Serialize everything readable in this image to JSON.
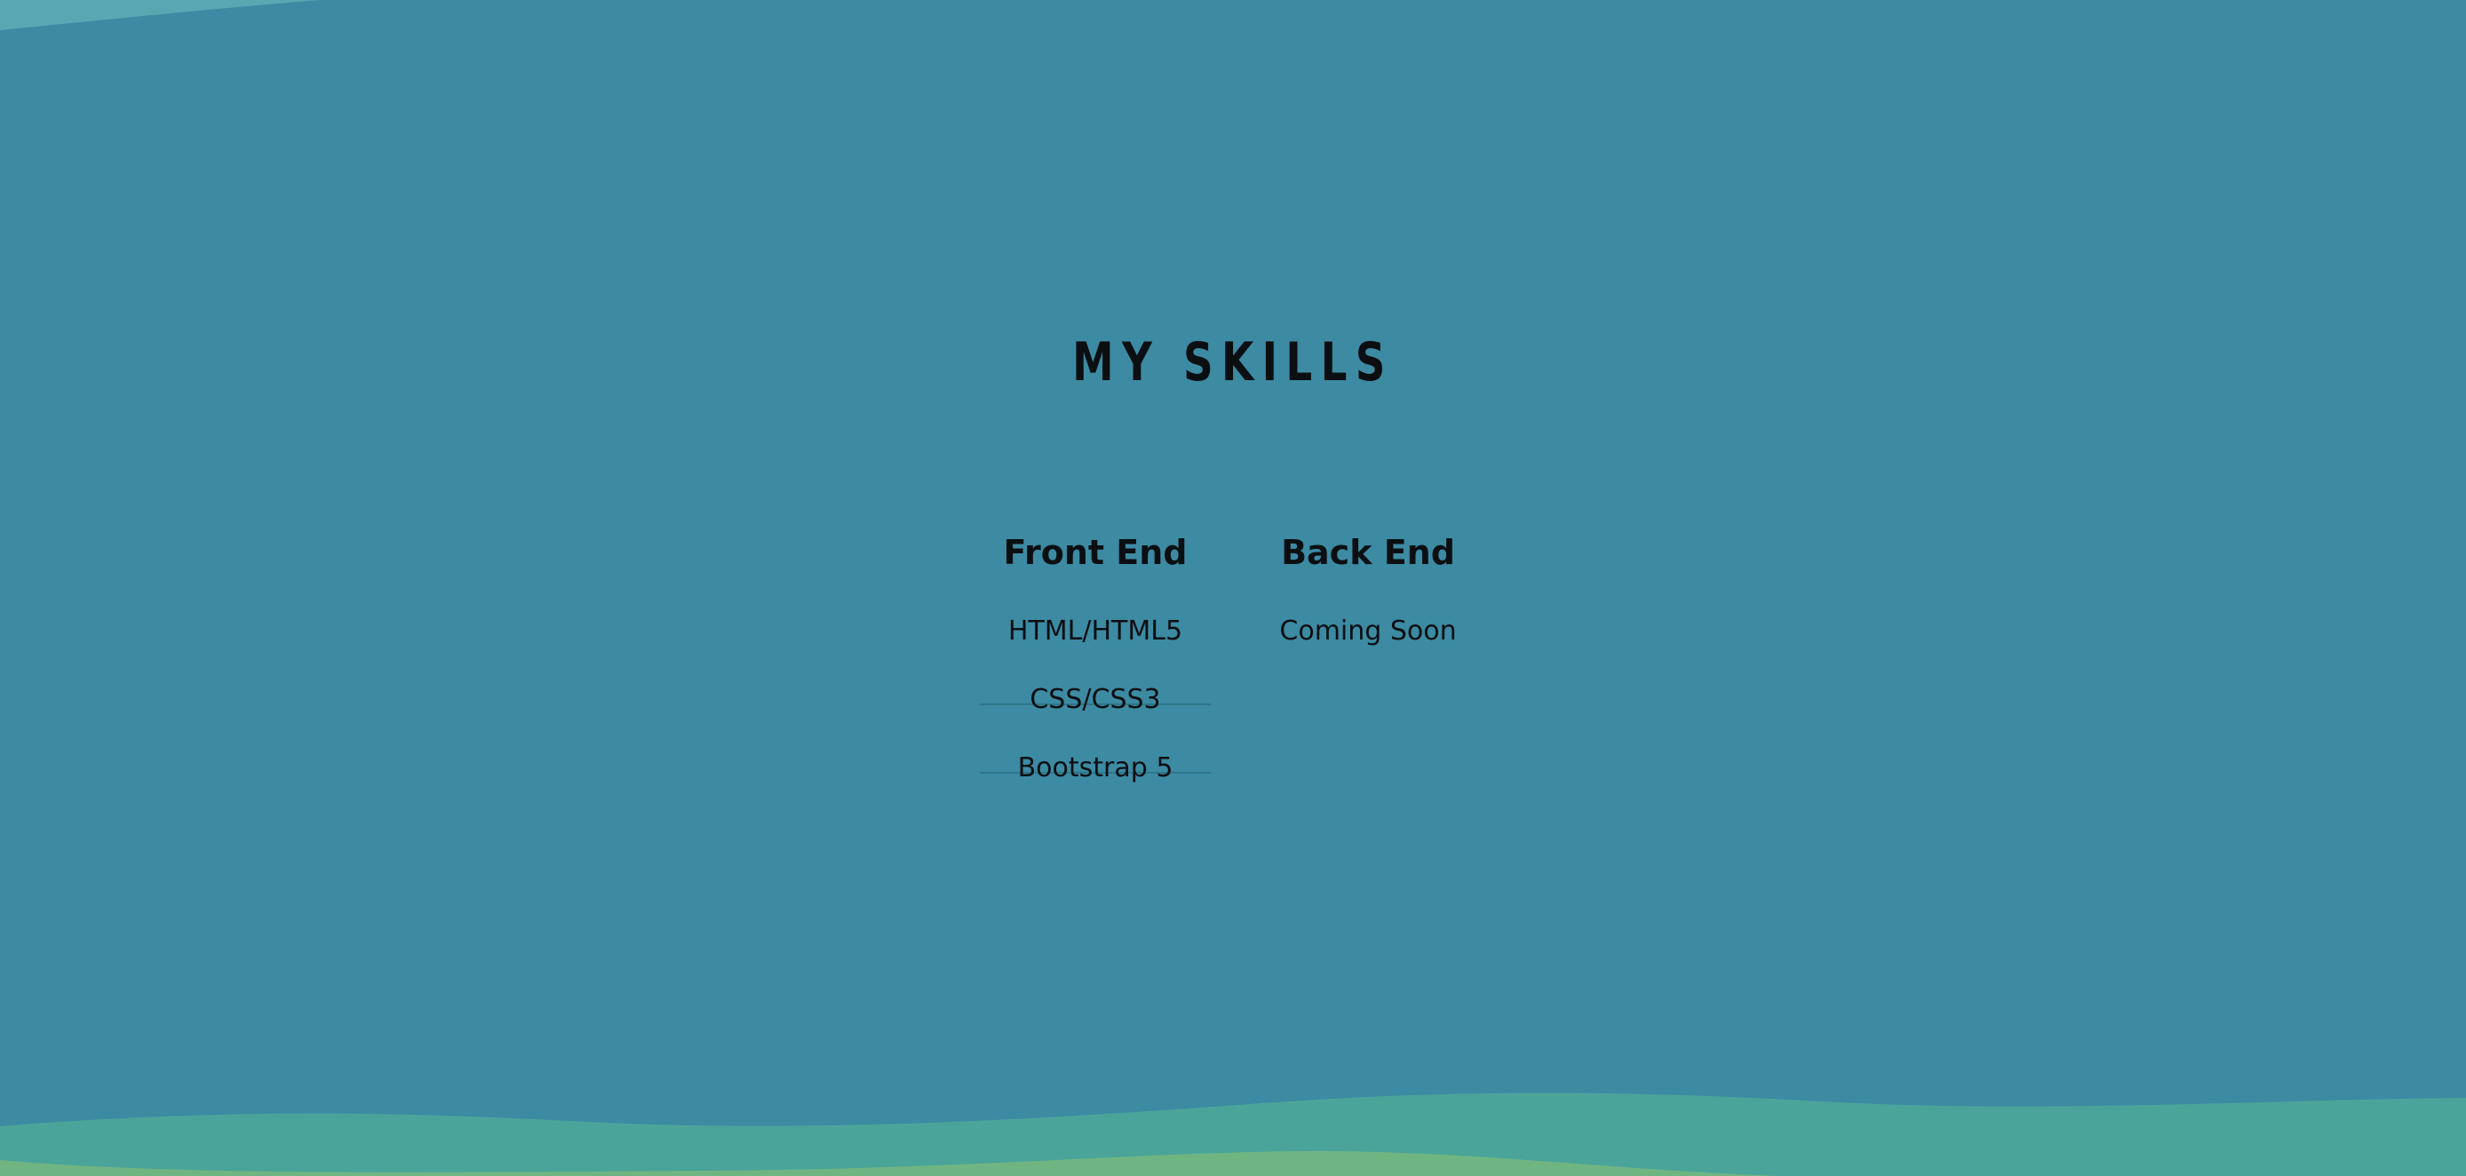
{
  "title": "MY SKILLS",
  "columns": [
    {
      "heading": "Front End",
      "items": [
        "HTML/HTML5",
        "CSS/CSS3",
        "Bootstrap 5"
      ]
    },
    {
      "heading": "Back End",
      "items": [
        "Coming Soon"
      ]
    }
  ],
  "colors": {
    "background": "#3d8aa3",
    "wave_top": "#5aa7b4",
    "wave_teal": "#4aa49a",
    "wave_green": "#6fb582",
    "divider": "#2f7689",
    "text": "#0b0f12"
  }
}
